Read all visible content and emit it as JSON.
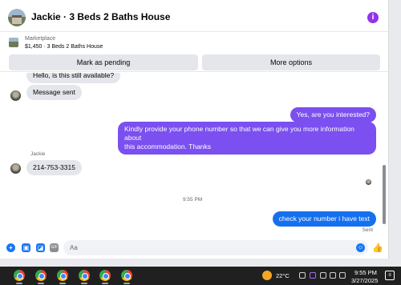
{
  "header": {
    "title": "Jackie · 3 Beds 2 Baths House",
    "more_icon": "more-options-icon"
  },
  "listing": {
    "label": "Marketplace",
    "price_title": "$1,450 · 3 Beds 2 Baths House",
    "pending_button": "Mark as pending",
    "more_button": "More options"
  },
  "messages": {
    "partial": "Hello, is this still available?",
    "sent_msg": "Message sent",
    "q1": "Yes, are you interested?",
    "q2_line1": "Kindly provide your phone number so that we can give you more information about",
    "q2_line2": "this accommodation. Thanks",
    "sender_name": "Jackie",
    "phone": "214-753-3315",
    "timestamp": "9:55 PM",
    "reply": "check your number i have text",
    "status": "Sent"
  },
  "composer": {
    "placeholder": "Aa"
  },
  "taskbar": {
    "temperature": "22°C",
    "time": "9:55 PM",
    "date": "3/27/2025"
  },
  "colors": {
    "accent": "#1877f2",
    "outgoing": "#7b4ff0",
    "more": "#9333ea"
  }
}
